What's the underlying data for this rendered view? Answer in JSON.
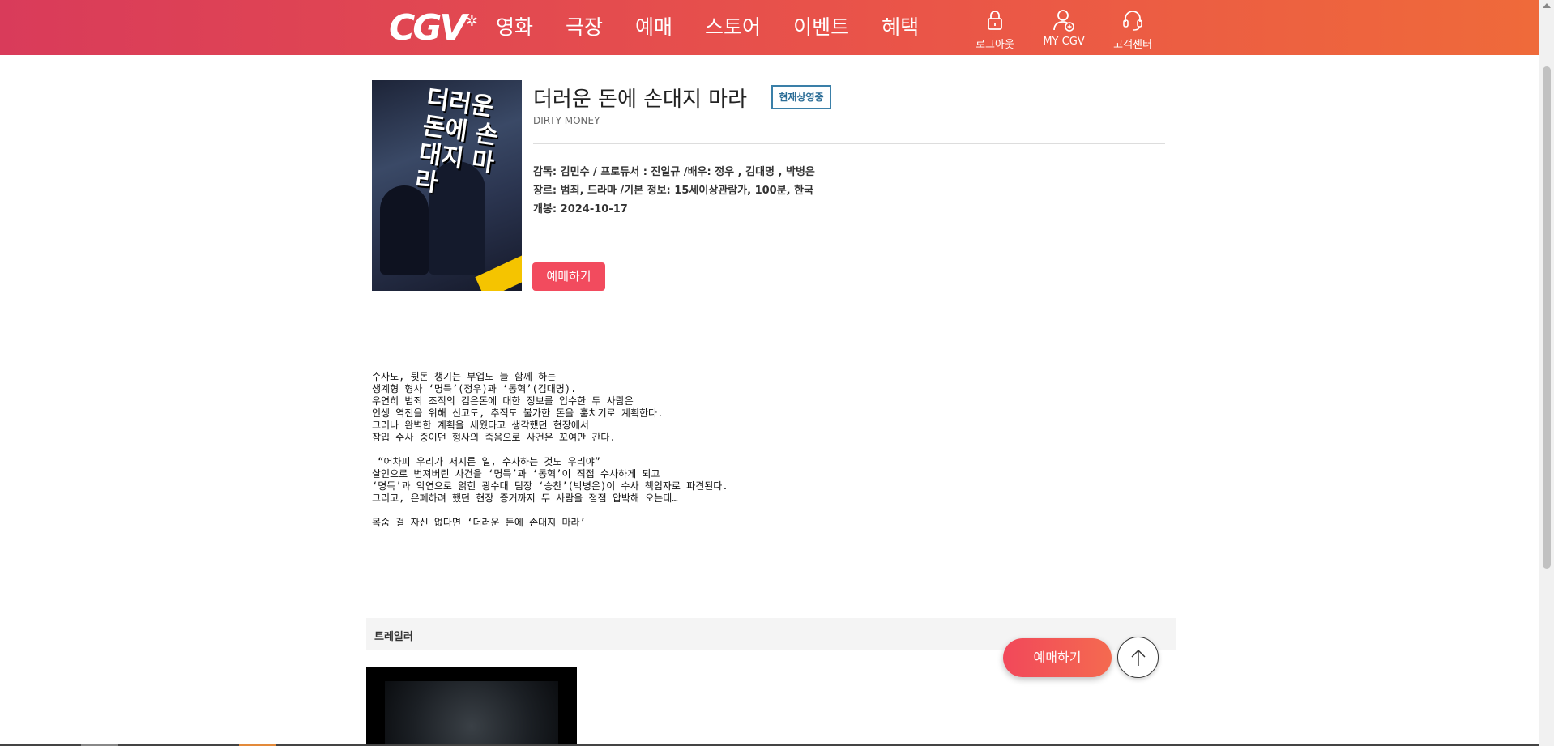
{
  "header": {
    "logo": "CGV",
    "nav": [
      "영화",
      "극장",
      "예매",
      "스토어",
      "이벤트",
      "혜택"
    ],
    "utils": [
      {
        "label": "로그아웃",
        "icon": "lock-icon"
      },
      {
        "label": "MY CGV",
        "icon": "user-plus-icon"
      },
      {
        "label": "고객센터",
        "icon": "headset-icon"
      }
    ],
    "gradient": [
      "#d93b5a",
      "#ef6a3a"
    ]
  },
  "movie": {
    "title": "더러운 돈에 손대지 마라",
    "status": "현재상영중",
    "english_title": "DIRTY MONEY",
    "credits": "감독: 김민수 / 프로듀서 : 진일규  /배우: 정우 , 김대명 , 박병은",
    "genre_info": "장르: 범죄, 드라마  /기본 정보: 15세이상관람가, 100분, 한국",
    "release": "개봉: 2024-10-17",
    "reserve_label": "예매하기",
    "poster_title": "더러운 돈에 손대지 마라"
  },
  "synopsis": [
    "수사도, 뒷돈 챙기는 부업도 늘 함께 하는",
    "생계형 형사 ‘명득’(정우)과 ‘동혁’(김대명).",
    "우연히 범죄 조직의 검은돈에 대한 정보를 입수한 두 사람은",
    "인생 역전을 위해 신고도, 추적도 불가한 돈을 훔치기로 계획한다.",
    "그러나 완벽한 계획을 세웠다고 생각했던 현장에서",
    "잠입 수사 중이던 형사의 죽음으로 사건은 꼬여만 간다.",
    "",
    " “어차피 우리가 저지른 일, 수사하는 것도 우리야”",
    "살인으로 번져버린 사건을 ‘명득’과 ‘동혁’이 직접 수사하게 되고",
    "‘명득’과 악연으로 얽힌 광수대 팀장 ‘승찬’(박병은)이 수사 책임자로 파견된다.",
    "그리고, 은폐하려 했던 현장 증거까지 두 사람을 점점 압박해 오는데…",
    "",
    "목숨 걸 자신 없다면 ‘더러운 돈에 손대지 마라’"
  ],
  "trailer": {
    "section_label": "트레일러"
  },
  "floating": {
    "reserve_label": "예매하기",
    "top_icon": "arrow-up-icon"
  }
}
